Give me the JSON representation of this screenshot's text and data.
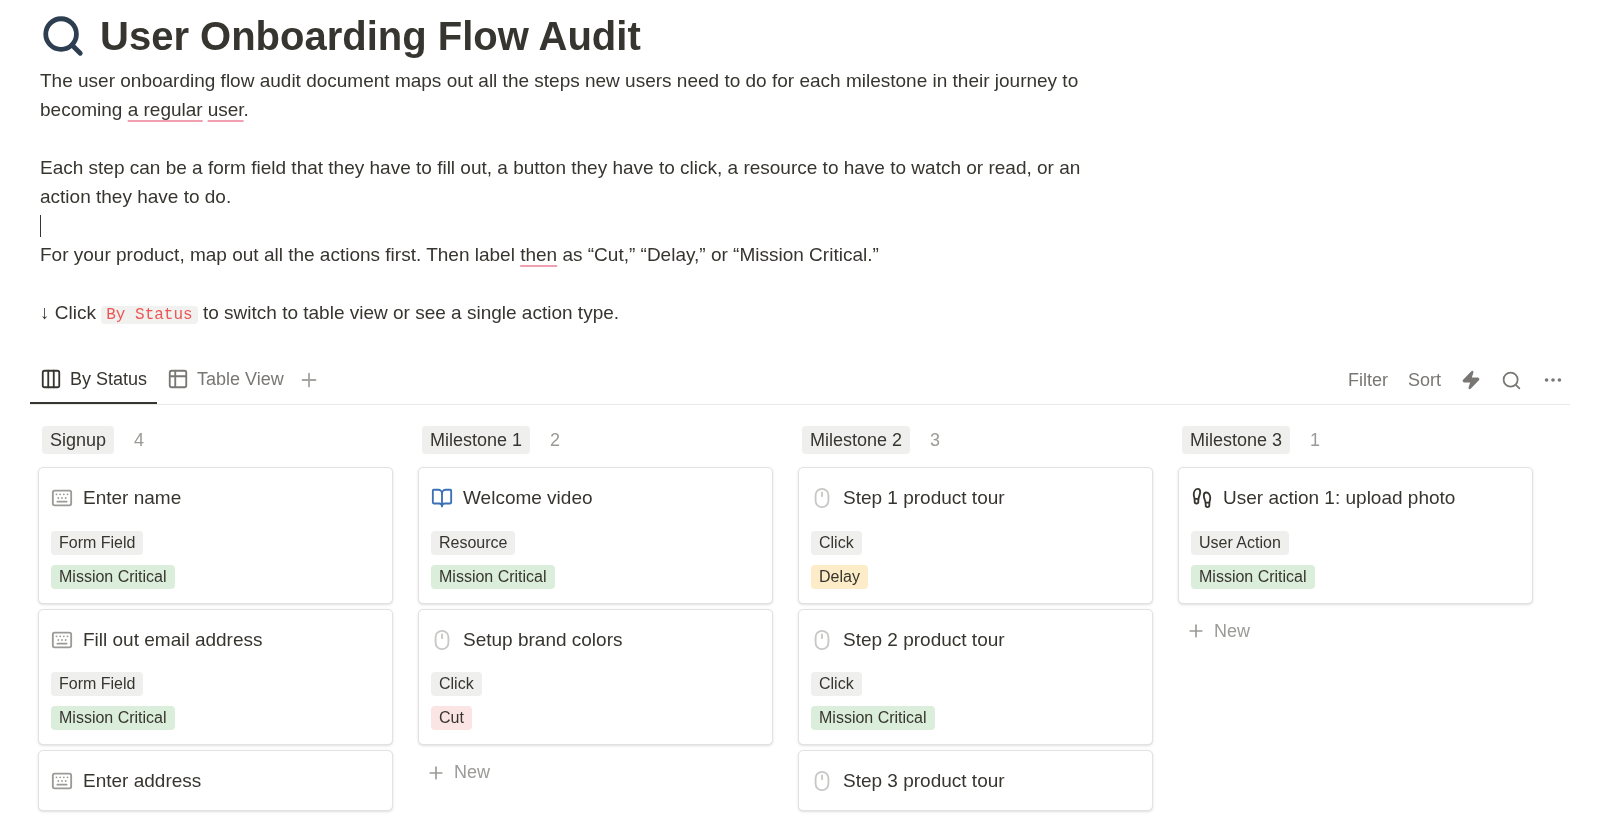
{
  "page": {
    "title": "User Onboarding Flow Audit",
    "paragraphs": [
      [
        {
          "kind": "text",
          "text": "The user onboarding flow audit document maps out all the steps new users need to do for each milestone in their journey to becoming "
        },
        {
          "kind": "flagged",
          "text": "a regular"
        },
        {
          "kind": "flagged",
          "text": "user"
        },
        {
          "kind": "text",
          "text": "."
        }
      ],
      [
        {
          "kind": "text",
          "text": "Each step can be a form field that they have to fill out, a button they have to click, a resource to have to watch or read, or an action they have to do."
        }
      ],
      [
        {
          "kind": "text",
          "text": "For your product, map out all the actions first. Then label "
        },
        {
          "kind": "flagged",
          "text": "then"
        },
        {
          "kind": "text",
          "text": " as “Cut,” “Delay,” or “Mission Critical.”"
        }
      ],
      [
        {
          "kind": "text",
          "text": "↓ Click "
        },
        {
          "kind": "code",
          "text": "By Status"
        },
        {
          "kind": "text",
          "text": " to switch to table view or see a single action type."
        }
      ]
    ]
  },
  "views": [
    {
      "kind": "board",
      "label": "By Status",
      "selected": true
    },
    {
      "kind": "table",
      "label": "Table View",
      "selected": false
    }
  ],
  "toolbar": [
    "Filter",
    "Sort"
  ],
  "columns": [
    {
      "name": "Signup",
      "count": "4",
      "cards": [
        {
          "kind": "form_field",
          "title": "Enter name",
          "type": "Form Field",
          "status": {
            "label": "Mission Critical",
            "color": "#dbeddb"
          }
        },
        {
          "kind": "form_field",
          "title": "Fill out email address",
          "type": "Form Field",
          "status": {
            "label": "Mission Critical",
            "color": "#dbeddb"
          }
        },
        {
          "kind": "form_field",
          "title": "Enter address"
        }
      ]
    },
    {
      "name": "Milestone 1",
      "count": "2",
      "new_label": "New",
      "cards": [
        {
          "kind": "resource",
          "title": "Welcome video",
          "type": "Resource",
          "status": {
            "label": "Mission Critical",
            "color": "#dbeddb"
          }
        },
        {
          "kind": "click",
          "title": "Setup brand colors",
          "type": "Click",
          "status": {
            "label": "Cut",
            "color": "#fbe4e4"
          }
        }
      ]
    },
    {
      "name": "Milestone 2",
      "count": "3",
      "cards": [
        {
          "kind": "click",
          "title": "Step 1 product tour",
          "type": "Click",
          "status": {
            "label": "Delay",
            "color": "#fdecc8"
          }
        },
        {
          "kind": "click",
          "title": "Step 2 product tour",
          "type": "Click",
          "status": {
            "label": "Mission Critical",
            "color": "#dbeddb"
          }
        },
        {
          "kind": "click",
          "title": "Step 3 product tour"
        }
      ]
    },
    {
      "name": "Milestone 3",
      "count": "1",
      "new_label": "New",
      "cards": [
        {
          "kind": "user_action",
          "title": "User action 1: upload photo",
          "type": "User Action",
          "status": {
            "label": "Mission Critical",
            "color": "#dbeddb"
          }
        }
      ]
    }
  ]
}
